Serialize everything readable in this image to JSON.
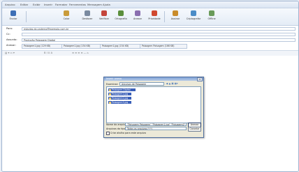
{
  "menu": [
    "Arquivo",
    "Editar",
    "Exibir",
    "Inserir",
    "Formatar",
    "Ferramentas",
    "Mensagem",
    "Ajuda"
  ],
  "toolbar": [
    {
      "label": "Enviar",
      "icon": "send-icon",
      "color": "#3d6fb6"
    },
    {
      "label": "Colar",
      "icon": "paste-icon",
      "color": "#c99b3a"
    },
    {
      "label": "Desfazer",
      "icon": "undo-icon",
      "color": "#7a8aa0"
    },
    {
      "label": "Verificar",
      "icon": "check-names-icon",
      "color": "#c4453b"
    },
    {
      "label": "Ortografia",
      "icon": "spelling-icon",
      "color": "#5b8f3c"
    },
    {
      "label": "Anexar",
      "icon": "attach-icon",
      "color": "#8a6fb0"
    },
    {
      "label": "Prioridade",
      "icon": "priority-icon",
      "color": "#d0482f"
    },
    {
      "label": "Assinar",
      "icon": "sign-icon",
      "color": "#c98c2b"
    },
    {
      "label": "Criptografar",
      "icon": "encrypt-icon",
      "color": "#4a8cc7"
    },
    {
      "label": "Offline",
      "icon": "offline-icon",
      "color": "#6a9b5a"
    }
  ],
  "fields": {
    "to": {
      "label": "Para:",
      "value": "estudos.do.caderno@exemplo.com.br"
    },
    "cc": {
      "label": "Cc:",
      "value": ""
    },
    "subject": {
      "label": "Assunto:",
      "value": "Produção Paisagem Digital"
    },
    "attach": {
      "label": "Anexar:"
    }
  },
  "attachments": [
    "Paisagem1.jpg (129 KB)",
    "Paisagem1.jpg (154 KB)",
    "Paisagem1.jpg (154 KB)",
    "Paisagem Paisagem (166 KB)"
  ],
  "dialog": {
    "title": "Inserir anexo",
    "lookin_label": "Examinar:",
    "lookin_value": "Arquivos de Paisagem",
    "files": [
      "Paisagem Digital",
      "Paisagem1.jpg",
      "Paisagem2.jpg",
      "Paisagem3.jpg"
    ],
    "filename_label": "Nome do arquivo:",
    "filename_value": "\"Paisagem Paisagem\" \"Paisagem1.jpg\" \"Paisagem2\"",
    "filetype_label": "Arquivos do tipo:",
    "filetype_value": "Todos os arquivos (*.*)",
    "attach_button": "Anexar",
    "cancel_button": "Cancelar",
    "shortcut_label": "Criar atalho para este arquivo",
    "close_glyph": "×"
  }
}
